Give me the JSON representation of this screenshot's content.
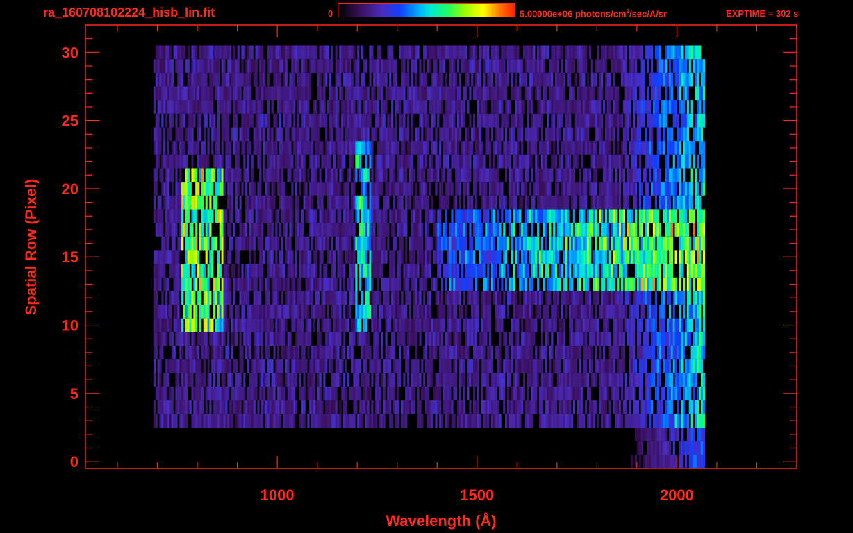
{
  "header": {
    "filename": "ra_160708102224_hisb_lin.fit",
    "colorbar_min": "0",
    "colorbar_max_prefix": "5.00000e+06 photons/cm",
    "colorbar_max_exp": "2",
    "colorbar_max_suffix": "/sec/A/sr",
    "exptime": "EXPTIME = 302 s"
  },
  "colors": {
    "axis": "#ff2a1a",
    "background": "#000000"
  },
  "chart_data": {
    "type": "heatmap",
    "xlabel": "Wavelength (Å)",
    "ylabel": "Spatial Row (Pixel)",
    "xlim": [
      520,
      2300
    ],
    "ylim": [
      -0.5,
      32
    ],
    "x_ticks": [
      1000,
      1500,
      2000
    ],
    "y_ticks": [
      0,
      5,
      10,
      15,
      20,
      25,
      30
    ],
    "x_tick_labels": [
      "1000",
      "1500",
      "2000"
    ],
    "y_tick_labels": [
      "0",
      "5",
      "10",
      "15",
      "20",
      "25",
      "30"
    ],
    "colorbar_range": [
      0,
      5000000
    ],
    "colorbar_unit": "photons/cm2/sec/A/sr",
    "rows": [
      0,
      30
    ],
    "wavelength_range": [
      690,
      2070
    ],
    "features": [
      {
        "kind": "diffuse emission",
        "x_range": [
          760,
          860
        ],
        "rows": [
          10,
          21
        ],
        "level": 0.7
      },
      {
        "kind": "emission line",
        "x_range": [
          1195,
          1230
        ],
        "rows": [
          10,
          23
        ],
        "level": 0.55
      },
      {
        "kind": "continuum",
        "x_range": [
          1400,
          2070
        ],
        "rows": [
          13,
          18
        ],
        "level": 0.7
      }
    ]
  }
}
